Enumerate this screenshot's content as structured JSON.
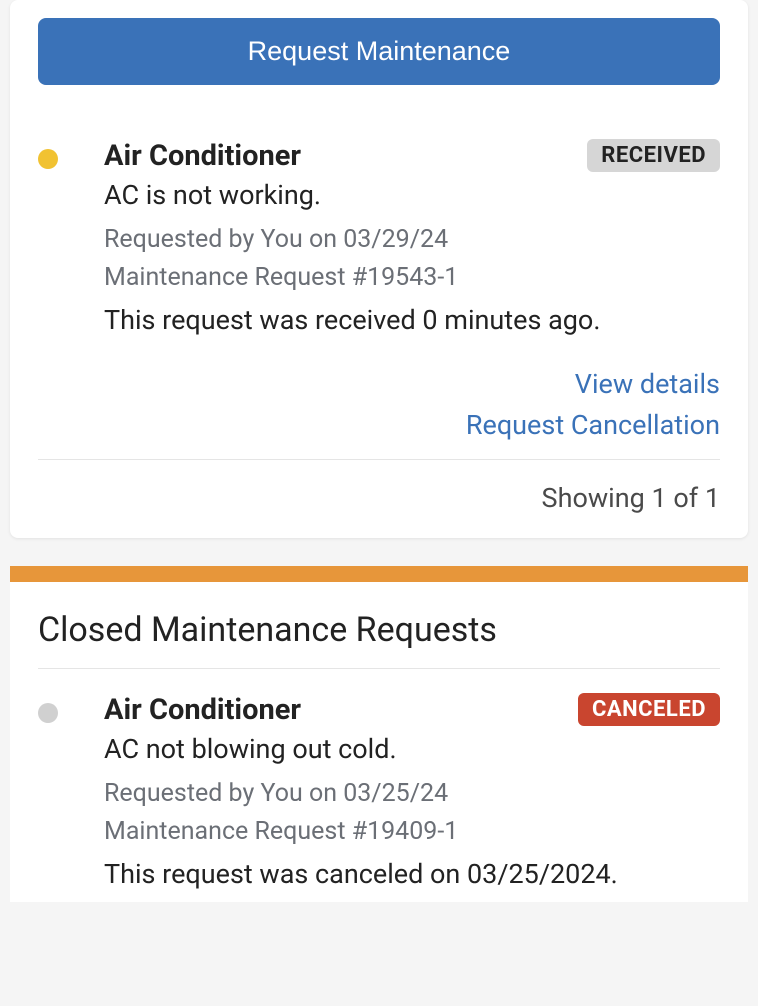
{
  "main": {
    "request_button_label": "Request Maintenance",
    "open_request": {
      "title": "Air Conditioner",
      "badge_text": "RECEIVED",
      "description": "AC is not working.",
      "requested_by": "Requested by You on 03/29/24",
      "request_number": "Maintenance Request #19543-1",
      "status_text": "This request was received 0 minutes ago.",
      "view_details_label": "View details",
      "cancel_label": "Request Cancellation"
    },
    "pagination": "Showing 1 of 1"
  },
  "closed": {
    "section_title": "Closed Maintenance Requests",
    "request": {
      "title": "Air Conditioner",
      "badge_text": "CANCELED",
      "description": "AC not blowing out cold.",
      "requested_by": "Requested by You on 03/25/24",
      "request_number": "Maintenance Request #19409-1",
      "status_text": "This request was canceled on 03/25/2024."
    }
  }
}
